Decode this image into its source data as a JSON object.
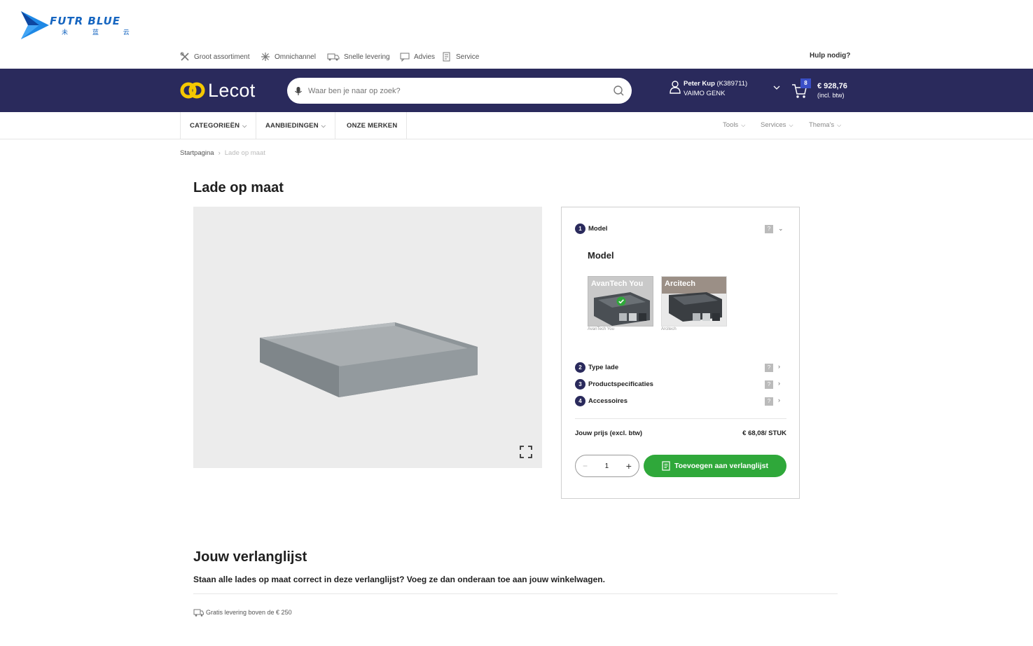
{
  "watermark": {
    "brand": "FUTR BLUE",
    "sub": "未 蓝 云"
  },
  "topbar": {
    "usps": [
      {
        "label": "Groot assortiment",
        "icon": "tools-icon"
      },
      {
        "label": "Omnichannel",
        "icon": "omnichannel-icon"
      },
      {
        "label": "Snelle levering",
        "icon": "truck-icon"
      },
      {
        "label": "Advies",
        "icon": "chat-icon"
      },
      {
        "label": "Service",
        "icon": "service-icon"
      }
    ],
    "help": "Hulp nodig?"
  },
  "header": {
    "logo_text": "Lecot",
    "search_placeholder": "Waar ben je naar op zoek?",
    "user_name": "Peter Kup",
    "user_id": "(K389711)",
    "user_org": "VAIMO GENK",
    "cart_count": "8",
    "cart_total": "€ 928,76",
    "cart_vat": "(incl. btw)"
  },
  "nav": {
    "items": [
      "CATEGORIEËN",
      "AANBIEDINGEN",
      "ONZE MERKEN"
    ],
    "right": [
      "Tools",
      "Services",
      "Thema's"
    ]
  },
  "breadcrumb": {
    "home": "Startpagina",
    "current": "Lade op maat"
  },
  "page": {
    "title": "Lade op maat"
  },
  "config": {
    "steps": [
      {
        "num": "1",
        "label": "Model"
      },
      {
        "num": "2",
        "label": "Type lade"
      },
      {
        "num": "3",
        "label": "Productspecificaties"
      },
      {
        "num": "4",
        "label": "Accessoires"
      }
    ],
    "help_mark": "?",
    "model_heading": "Model",
    "models": [
      {
        "label": "AvanTech You",
        "caption": "AvanTech You",
        "selected": true
      },
      {
        "label": "Arcitech",
        "caption": "Arcitech",
        "selected": false
      }
    ],
    "price_label": "Jouw prijs (excl. btw)",
    "price_value": "€ 68,08/ STUK",
    "quantity": "1",
    "add_label": "Toevoegen aan verlanglijst"
  },
  "wishlist": {
    "title": "Jouw verlanglijst",
    "text": "Staan alle lades op maat correct in deze verlanglijst? Voeg ze dan onderaan toe aan jouw winkelwagen.",
    "delivery": "Gratis levering boven de € 250"
  },
  "colors": {
    "header": "#2a2a5c",
    "accent_green": "#2fa83a",
    "logo_yellow": "#f5c800",
    "badge": "#3a4fc7",
    "drawer": "#8e9599"
  }
}
